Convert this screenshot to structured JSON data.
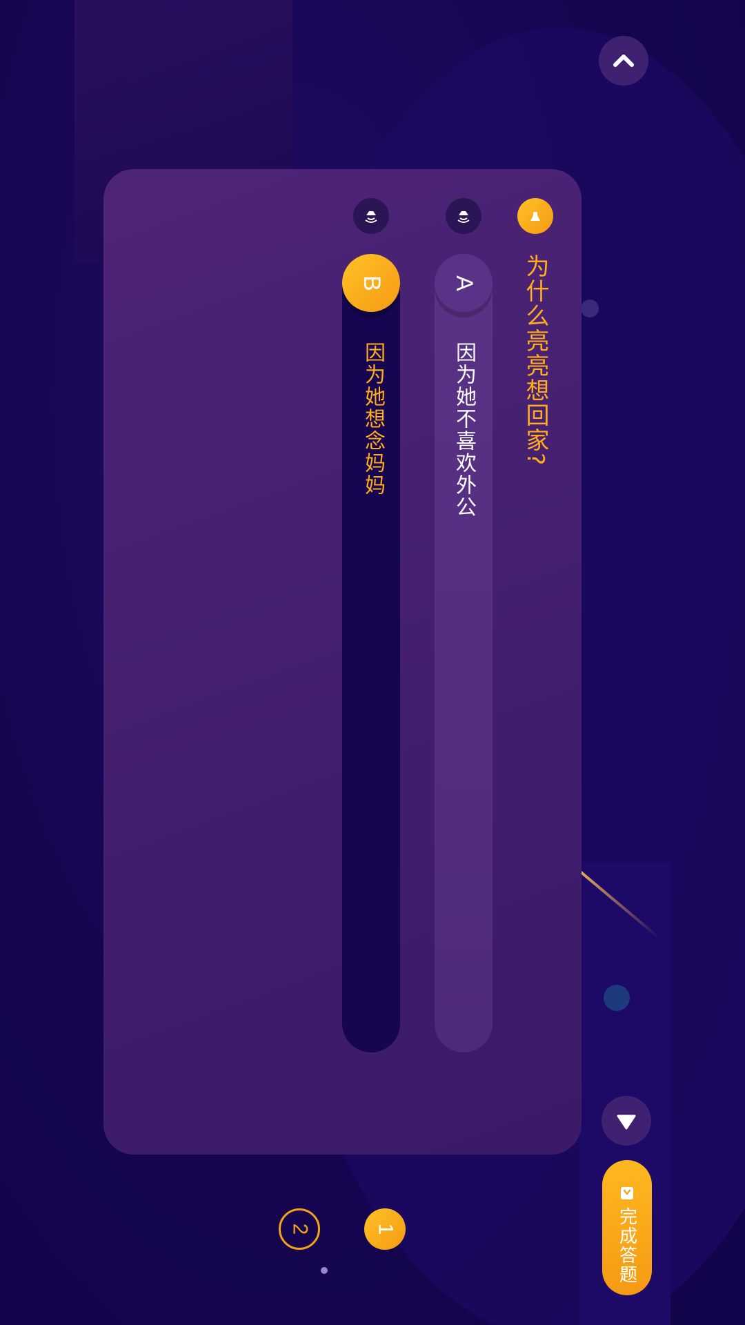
{
  "question": {
    "text": "为什么亮亮想回家?"
  },
  "options": [
    {
      "letter": "A",
      "text": "因为她不喜欢外公"
    },
    {
      "letter": "B",
      "text": "因为她想念妈妈"
    }
  ],
  "actions": {
    "finish_label": "完成答题"
  },
  "pagination": {
    "pages": [
      "1",
      "2"
    ],
    "current": "1"
  },
  "icons": {
    "up": "chevron-up-icon",
    "down": "triangle-down-icon",
    "speaker": "speaker-icon",
    "finish": "check-document-icon"
  },
  "colors": {
    "background": "#16054d",
    "card": "#4a2274",
    "accent": "#ffad1f",
    "selected_track": "#160550"
  }
}
